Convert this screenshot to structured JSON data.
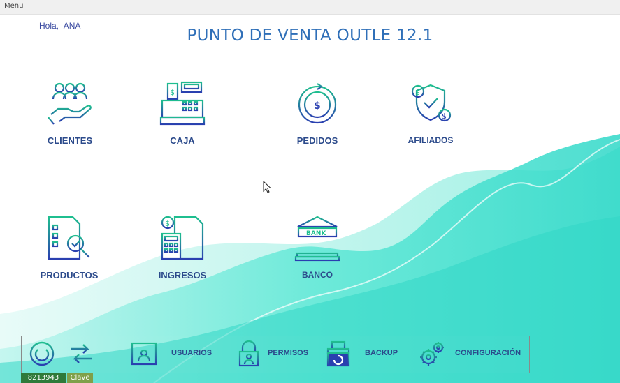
{
  "menu": {
    "label": "Menu"
  },
  "greeting": {
    "hello": "Hola,",
    "user": "ANA"
  },
  "title": "PUNTO DE VENTA OUTLE 12.1",
  "tiles": {
    "clientes": "CLIENTES",
    "caja": "CAJA",
    "pedidos": "PEDIDOS",
    "afiliados": "AFILIADOS",
    "productos": "PRODUCTOS",
    "ingresos": "INGRESOS",
    "banco": "BANCO"
  },
  "bottom": {
    "usuarios": "USUARIOS",
    "permisos": "PERMISOS",
    "backup": "BACKUP",
    "configuracion": "CONFIGURACIÓN"
  },
  "status": {
    "code": "8213943",
    "key": "Clave"
  },
  "colors": {
    "icon_start": "#1fbf8f",
    "icon_end": "#2a3fb0",
    "wave": "#3fe0cf",
    "title": "#2f6fb8"
  },
  "icons": [
    "people-hand-icon",
    "cash-register-icon",
    "clock-dollar-icon",
    "shield-dollar-icon",
    "document-search-icon",
    "invoice-calculator-icon",
    "bank-icon",
    "power-icon",
    "swap-arrows-icon",
    "user-card-icon",
    "padlock-user-icon",
    "database-backup-icon",
    "gears-icon"
  ]
}
